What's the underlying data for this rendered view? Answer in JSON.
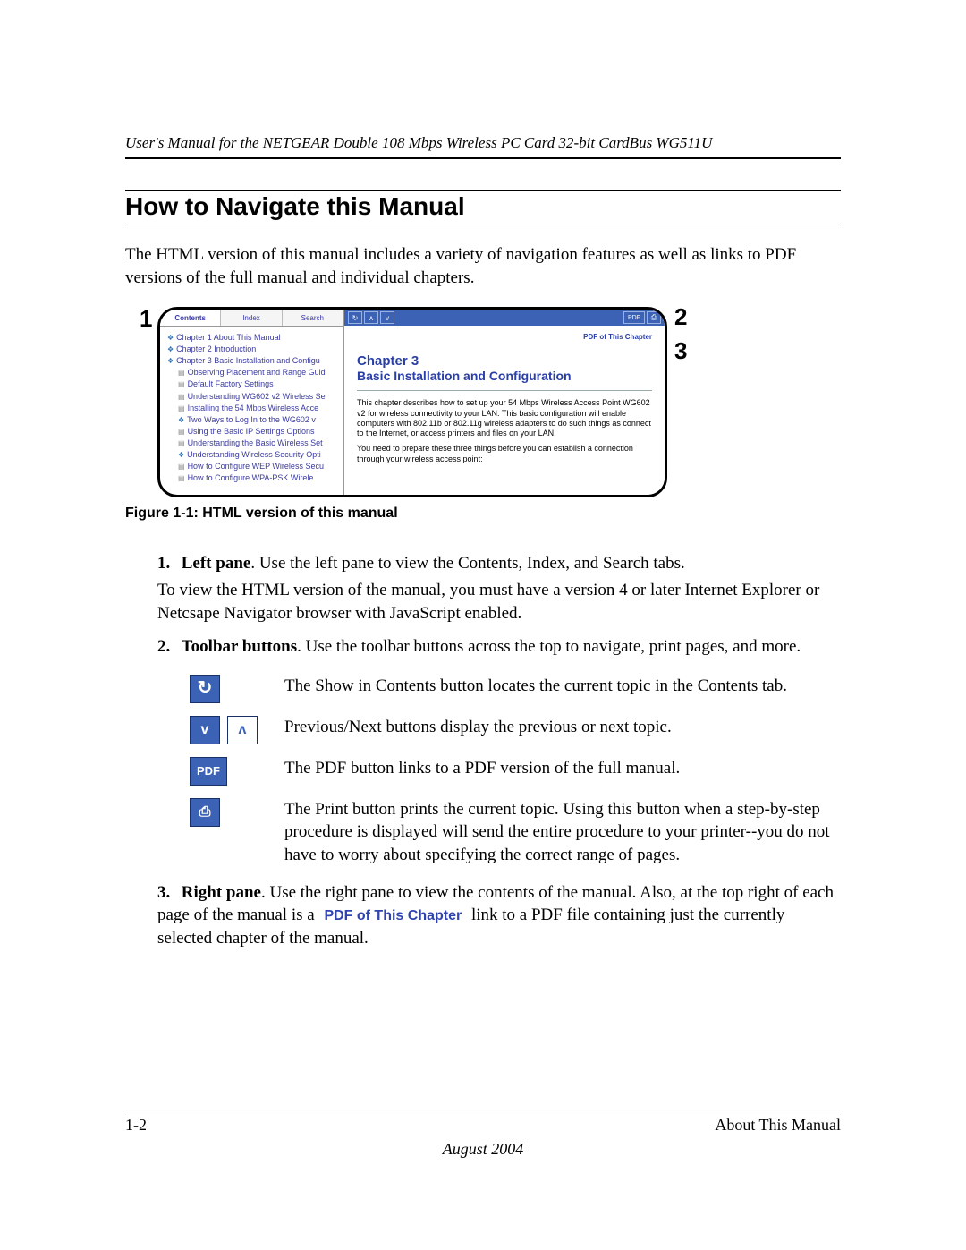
{
  "header": {
    "running": "User's Manual for the NETGEAR Double 108 Mbps Wireless PC Card 32-bit CardBus WG511U"
  },
  "section": {
    "title": "How to Navigate this Manual",
    "intro": "The HTML version of this manual includes a variety of navigation features as well as links to PDF versions of the full manual and individual chapters."
  },
  "figure": {
    "callouts": {
      "c1": "1",
      "c2": "2",
      "c3": "3"
    },
    "tabs": {
      "contents": "Contents",
      "index": "Index",
      "search": "Search"
    },
    "toolbar": {
      "sync": "↻",
      "up": "ᴧ",
      "down": "v",
      "pdf": "PDF",
      "print": "⎙"
    },
    "tree": [
      "Chapter 1 About This Manual",
      "Chapter 2 Introduction",
      "Chapter 3 Basic Installation and Configu",
      "Observing Placement and Range Guid",
      "Default Factory Settings",
      "Understanding WG602 v2 Wireless Se",
      "Installing the 54 Mbps Wireless Acce",
      "Two Ways to Log In to the WG602 v",
      "Using the Basic IP Settings Options",
      "Understanding the Basic Wireless Set",
      "Understanding Wireless Security Opti",
      "How to Configure WEP Wireless Secu",
      "How to Configure WPA-PSK Wirele"
    ],
    "content": {
      "pdf_link": "PDF of This Chapter",
      "chapter_title": "Chapter 3",
      "chapter_sub": "Basic Installation and Configuration",
      "para1": "This chapter describes how to set up your 54 Mbps Wireless Access Point WG602 v2 for wireless connectivity to your LAN. This basic configuration will enable computers with 802.11b or 802.11g wireless adapters to do such things as connect to the Internet, or access printers and files on your LAN.",
      "para2": "You need to prepare these three things before you can establish a connection through your wireless access point:"
    },
    "caption": "Figure 1-1:  HTML version of this manual"
  },
  "list": {
    "i1": {
      "num": "1.",
      "term": "Left pane",
      "text": ". Use the left pane to view the Contents, Index, and Search tabs.",
      "extra": "To view the HTML version of the manual, you must have a version 4 or later Internet Explorer or Netcsape Navigator browser with JavaScript enabled."
    },
    "i2": {
      "num": "2.",
      "term": "Toolbar buttons",
      "text": ". Use the toolbar buttons across the top to navigate, print pages, and more."
    },
    "buttons": {
      "sync": {
        "glyph": "↻",
        "desc": "The Show in Contents button locates the current topic in the Contents tab."
      },
      "prevnext": {
        "down": "v",
        "up": "ᴧ",
        "desc": "Previous/Next buttons display the previous or next topic."
      },
      "pdf": {
        "label": "PDF",
        "desc": "The PDF button links to a PDF version of the full manual."
      },
      "print": {
        "glyph": "⎙",
        "desc": "The Print button prints the current topic. Using this button when a step-by-step procedure is displayed will send the entire procedure to your printer--you do not have to worry about specifying the correct range of pages."
      }
    },
    "i3": {
      "num": "3.",
      "term": "Right pane",
      "pre": ". Use the right pane to view the contents of the manual. Also, at the top right of each page of the manual is a ",
      "link": "PDF of This Chapter",
      "post": " link to a PDF file containing just the currently selected chapter of the manual."
    }
  },
  "footer": {
    "page": "1-2",
    "section": "About This Manual",
    "date": "August 2004"
  }
}
